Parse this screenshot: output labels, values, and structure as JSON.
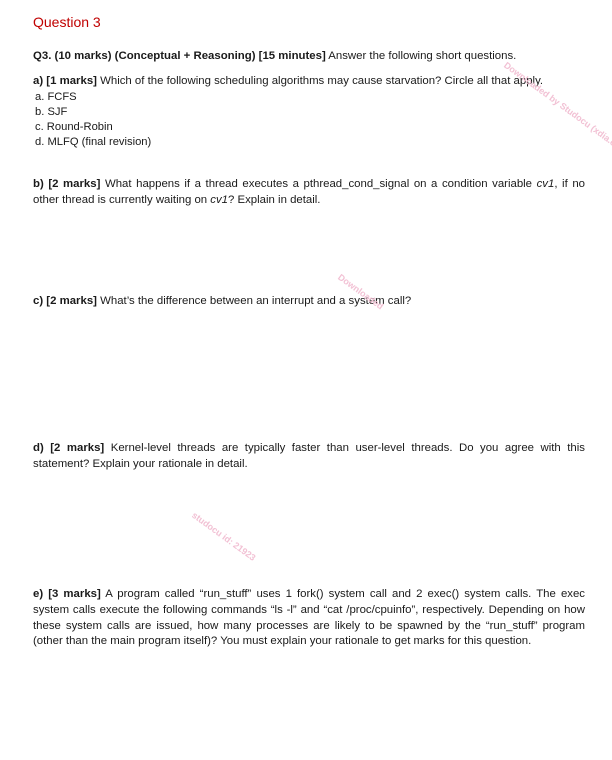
{
  "page_label": "Question 3",
  "intro": {
    "bold": "Q3. (10 marks) (Conceptual + Reasoning) [15 minutes]",
    "text": " Answer the following short questions."
  },
  "questions": [
    {
      "id": "a",
      "bold": "a) [1 marks]",
      "text": " Which of the following scheduling algorithms may cause starvation? Circle all that apply.",
      "options": [
        "a. FCFS",
        "b. SJF",
        "c. Round-Robin",
        "d. MLFQ (final revision)"
      ]
    },
    {
      "id": "b",
      "bold": "b) [2 marks]",
      "text_1": " What happens if a thread executes a pthread_cond_signal on a condition variable ",
      "italic_1": "cv1",
      "text_2": ", if no other thread is currently waiting on ",
      "italic_2": "cv1",
      "text_3": "? Explain in detail."
    },
    {
      "id": "c",
      "bold": "c) [2 marks]",
      "text": " What’s the difference between an interrupt and a system call?"
    },
    {
      "id": "d",
      "bold": "d) [2 marks]",
      "text": " Kernel-level threads are typically faster than user-level threads. Do you agree with this statement? Explain your rationale in detail."
    },
    {
      "id": "e",
      "bold": "e) [3 marks]",
      "text": " A program called “run_stuff” uses 1 fork() system call and 2 exec() system calls. The exec system calls execute the following commands “ls -l” and “cat /proc/cpuinfo”, respectively. Depending on how these system calls are issued, how many processes are likely to be spawned by the “run_stuff” program (other than the main program itself)? You must explain your rationale to get marks for this question."
    }
  ],
  "watermarks": [
    "Downloaded by Studocu (xdia.com)",
    "Downloaded",
    "studocu id: 21923"
  ],
  "colors": {
    "heading": "#c00000",
    "text": "#1a1a1a",
    "watermark": "#f2c1d4"
  }
}
